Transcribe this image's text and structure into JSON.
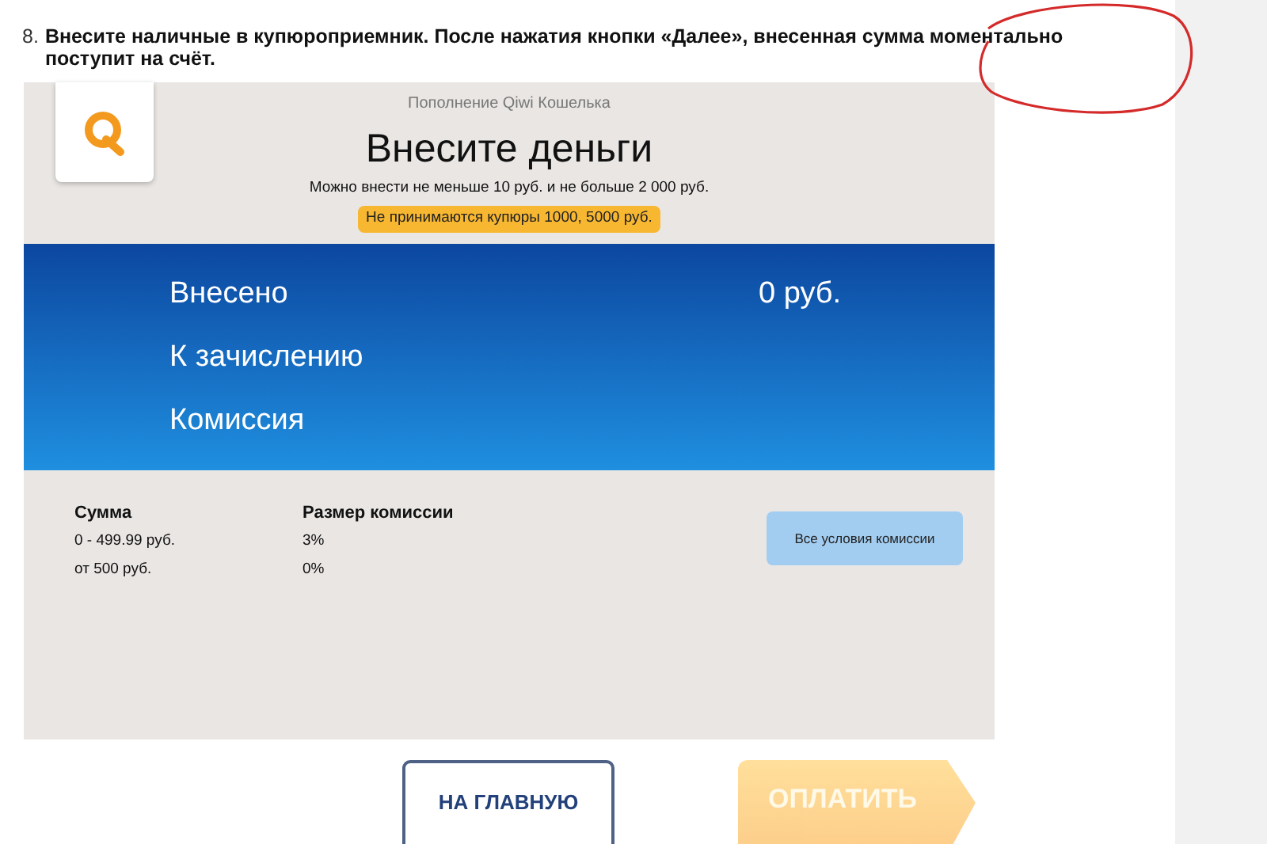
{
  "step": {
    "number": "8.",
    "text": "Внесите наличные в купюроприемник. После нажатия кнопки «Далее», внесенная сумма моментально поступит на счёт."
  },
  "annotation": {
    "kind": "circle",
    "color": "#d42a2a"
  },
  "terminal": {
    "header": {
      "subtitle": "Пополнение Qiwi Кошелька",
      "title": "Внесите деньги",
      "limits": "Можно внести не меньше 10 руб. и не больше 2 000 руб.",
      "warning": "Не принимаются купюры 1000, 5000 руб."
    },
    "summary": [
      {
        "label": "Внесено",
        "value": "0 руб."
      },
      {
        "label": "К зачислению"
      },
      {
        "label": "Комиссия"
      }
    ],
    "commission_table": {
      "columns": [
        "Сумма",
        "Размер комиссии"
      ],
      "rows": [
        [
          "0 - 499.99 руб.",
          "3%"
        ],
        [
          "от 500 руб.",
          "0%"
        ]
      ]
    },
    "conditions_button": "Все условия комиссии"
  },
  "buttons": [
    {
      "kind": "outline",
      "label": "НА ГЛАВНУЮ",
      "disabled": false
    },
    {
      "kind": "arrow",
      "label": "ОПЛАТИТЬ",
      "disabled": true
    }
  ]
}
